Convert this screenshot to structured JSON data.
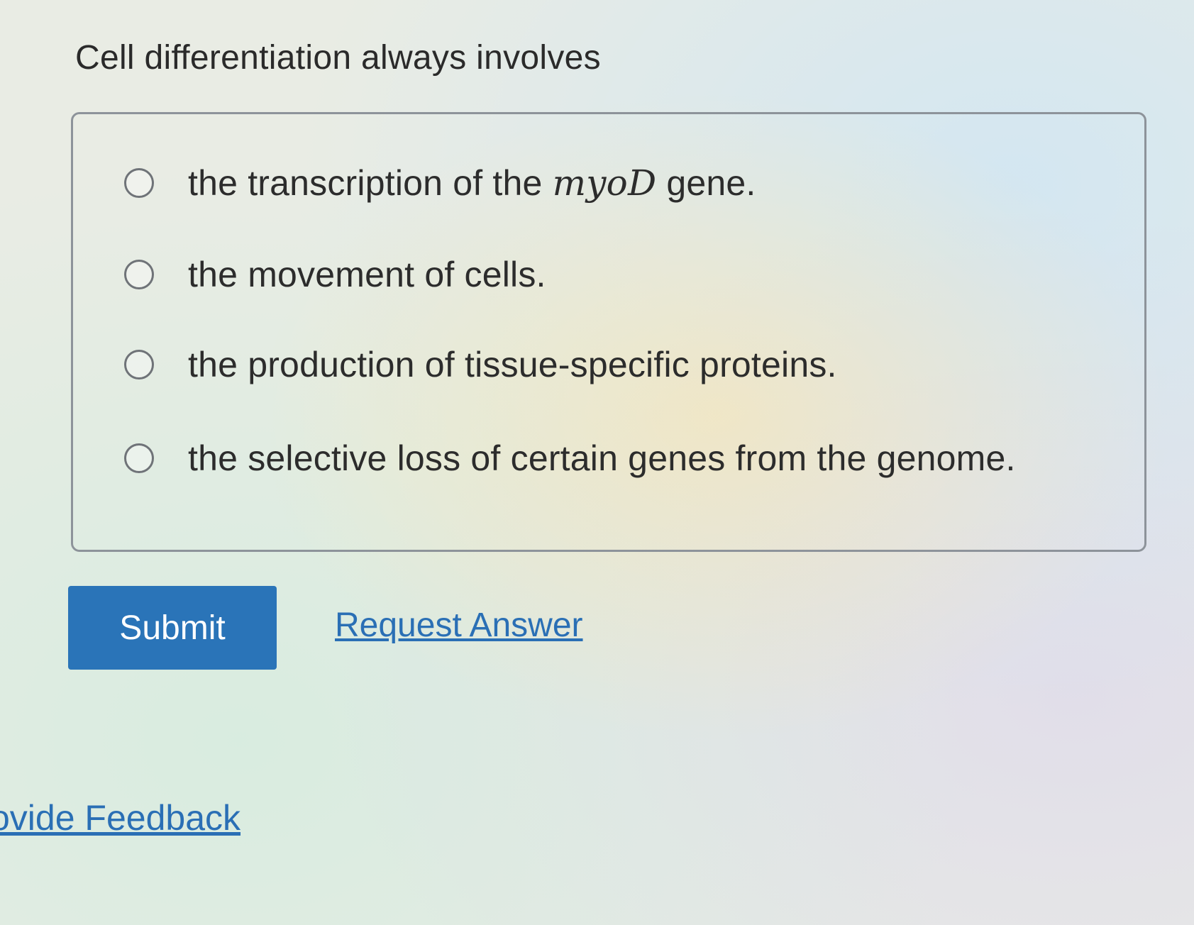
{
  "question": {
    "title": "Cell differentiation always involves"
  },
  "choices": [
    {
      "prefix": "the transcription of the ",
      "math": "myoD",
      "suffix": " gene.",
      "selected": false
    },
    {
      "prefix": "the movement of cells.",
      "math": "",
      "suffix": "",
      "selected": false
    },
    {
      "prefix": "the production of tissue-specific proteins.",
      "math": "",
      "suffix": "",
      "selected": false
    },
    {
      "prefix": "the selective loss of certain genes from the genome.",
      "math": "",
      "suffix": "",
      "selected": false
    }
  ],
  "actions": {
    "submit_label": "Submit",
    "request_answer_label": "Request Answer"
  },
  "footer": {
    "feedback_label": "ovide Feedback"
  },
  "colors": {
    "submit_bg": "#2a74b8",
    "link": "#2a6fb5",
    "box_border": "#8d939a"
  }
}
